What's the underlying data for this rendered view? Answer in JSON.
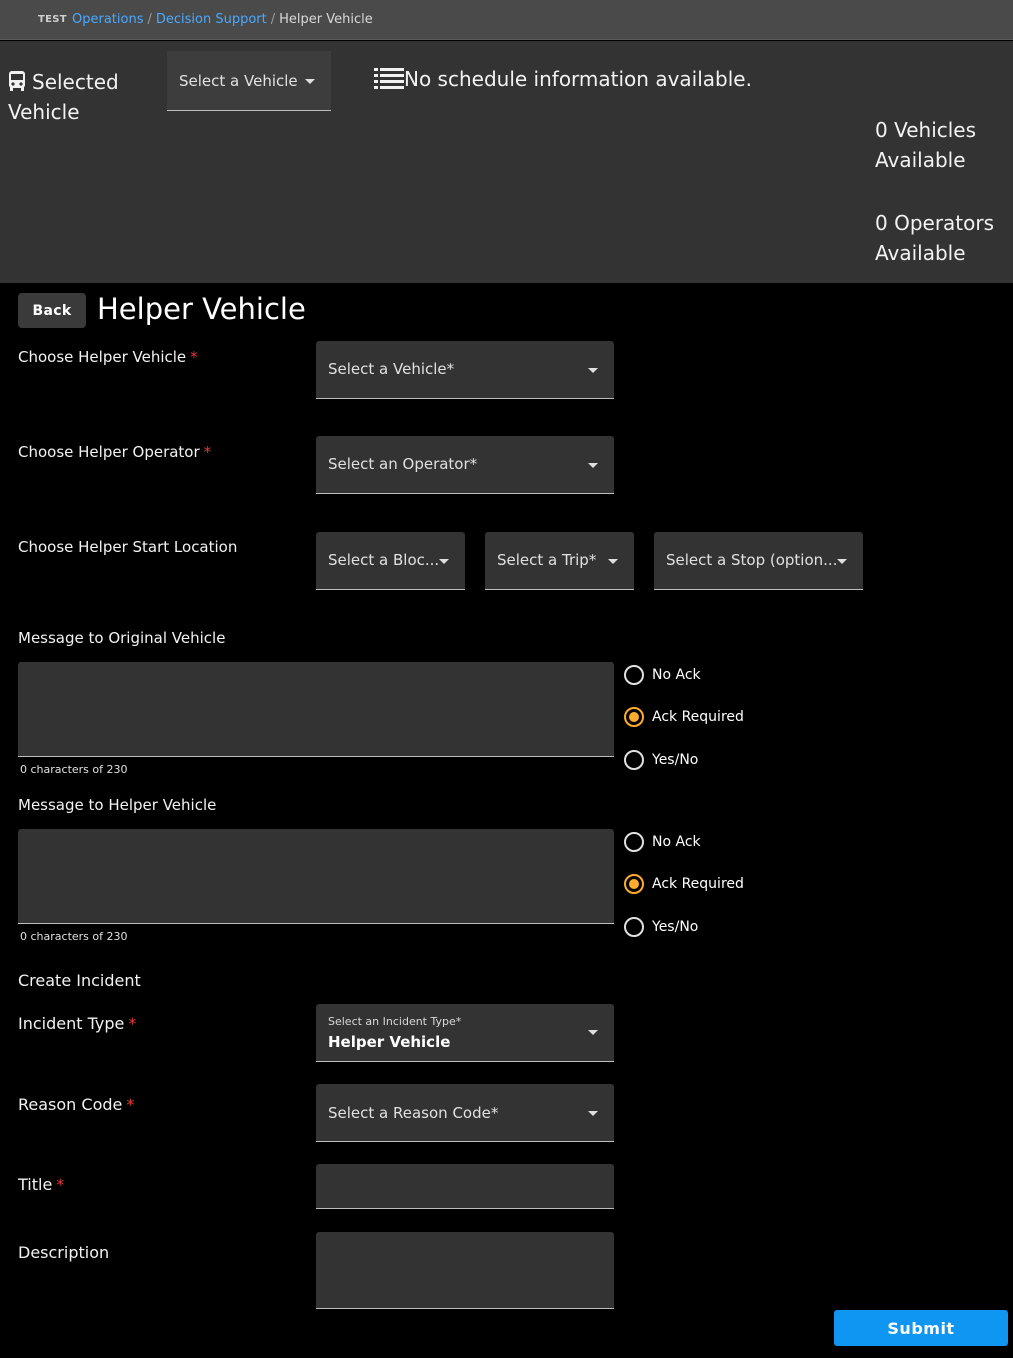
{
  "breadcrumb": {
    "env": "TEST",
    "items": [
      "Operations",
      "Decision Support"
    ],
    "current": "Helper Vehicle"
  },
  "header": {
    "selected_vehicle_label": "Selected Vehicle",
    "vehicle_select": "Select a Vehicle",
    "schedule_info": "No schedule information available.",
    "vehicles_available": "0 Vehicles Available",
    "operators_available": "0 Operators Available"
  },
  "page": {
    "back_label": "Back",
    "title": "Helper Vehicle"
  },
  "form": {
    "helper_vehicle_label": "Choose Helper Vehicle",
    "helper_vehicle_placeholder": "Select a Vehicle*",
    "helper_operator_label": "Choose Helper Operator",
    "helper_operator_placeholder": "Select an Operator*",
    "start_location_label": "Choose Helper Start Location",
    "block_placeholder": "Select a Bloc...",
    "trip_placeholder": "Select a Trip*",
    "stop_placeholder": "Select a Stop (option...",
    "required_mark": "*"
  },
  "message_original": {
    "label": "Message to Original Vehicle",
    "counter": "0 characters of 230",
    "options": [
      "No Ack",
      "Ack Required",
      "Yes/No"
    ],
    "selected": "Ack Required"
  },
  "message_helper": {
    "label": "Message to Helper Vehicle",
    "counter": "0 characters of 230",
    "options": [
      "No Ack",
      "Ack Required",
      "Yes/No"
    ],
    "selected": "Ack Required"
  },
  "incident": {
    "section_label": "Create Incident",
    "type_label": "Incident Type",
    "type_floating_label": "Select an Incident Type*",
    "type_value": "Helper Vehicle",
    "reason_label": "Reason Code",
    "reason_placeholder": "Select a Reason Code*",
    "title_label": "Title",
    "description_label": "Description"
  },
  "submit_label": "Submit",
  "colors": {
    "accent_link": "#4aa8ff",
    "radio_selected": "#ffab2e",
    "required": "#e53935",
    "submit": "#0f95f2"
  },
  "icons": [
    "bus-icon",
    "list-icon",
    "dropdown-caret-icon"
  ]
}
